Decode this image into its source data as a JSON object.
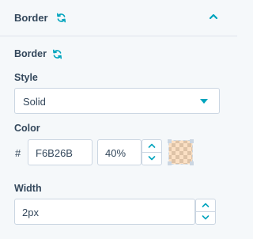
{
  "header": {
    "title": "Border",
    "refresh_icon": "refresh-icon",
    "collapse_icon": "chevron-up-icon"
  },
  "border_section": {
    "title": "Border",
    "style": {
      "label": "Style",
      "value": "Solid"
    },
    "color": {
      "label": "Color",
      "hash": "#",
      "hex_value": "F6B26B",
      "opacity_value": "40%",
      "swatch_color": "#F6B26B",
      "swatch_opacity": 0.4
    },
    "width": {
      "label": "Width",
      "value": "2px"
    }
  },
  "colors": {
    "accent": "#00a4bd",
    "text": "#33475b",
    "border": "#cbd6e2",
    "background": "#f5f8fa"
  }
}
